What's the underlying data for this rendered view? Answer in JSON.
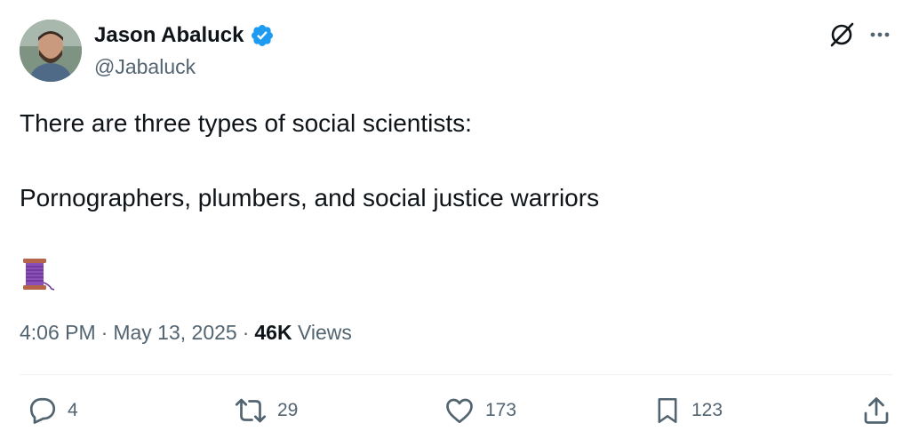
{
  "author": {
    "name": "Jason Abaluck",
    "handle": "@Jabaluck",
    "verified": true
  },
  "tweet": {
    "line1": "There are three types of social scientists:",
    "line2": "Pornographers, plumbers, and social justice warriors",
    "emoji": "thread-spool"
  },
  "meta": {
    "time": "4:06 PM",
    "separator": "·",
    "date": "May 13, 2025",
    "views_count": "46K",
    "views_label": "Views"
  },
  "actions": {
    "replies": "4",
    "reposts": "29",
    "likes": "173",
    "bookmarks": "123"
  },
  "icons": {
    "top": [
      "grok-icon",
      "more-icon"
    ],
    "actions": [
      "reply-icon",
      "repost-icon",
      "like-icon",
      "bookmark-icon",
      "share-icon"
    ]
  },
  "colors": {
    "text": "#0f1419",
    "secondary": "#536471",
    "verified": "#1d9bf0",
    "divider": "#eff3f4"
  }
}
